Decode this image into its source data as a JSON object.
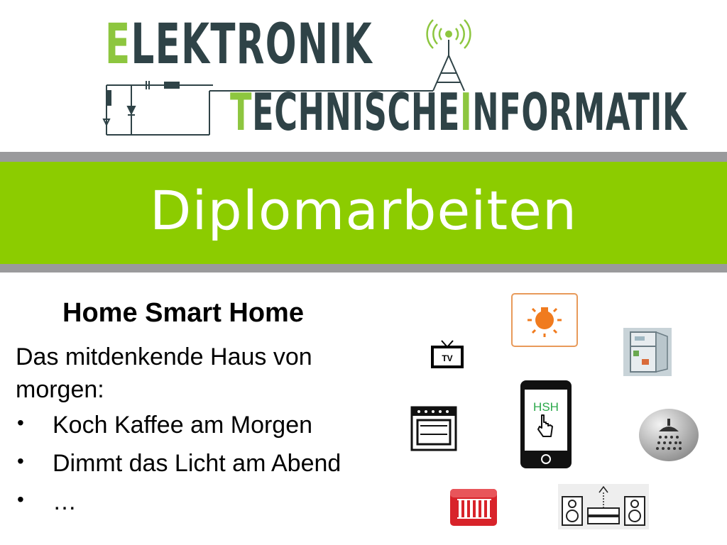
{
  "header": {
    "logo": {
      "word1_accent": "E",
      "word1_a": "LEK",
      "word1_b": "T",
      "word1_c": "RONIK",
      "word2_a": "T",
      "word2_b": "ECHNISCHE",
      "word2_c": "I",
      "word2_d": "NFORMATIK",
      "colors": {
        "dark": "#2f4347",
        "green": "#8dc63f"
      }
    },
    "banner_title": "Diplomarbeiten",
    "banner_color": "#8ccc00"
  },
  "content": {
    "subtitle": "Home Smart Home",
    "intro": "Das mitdenkende Haus von morgen:",
    "bullets": [
      {
        "marker": "•",
        "text": "Koch Kaffee am Morgen"
      },
      {
        "marker": "•",
        "text": "Dimmt das Licht am Abend"
      },
      {
        "marker": "•",
        "text": "…"
      }
    ]
  },
  "icons": {
    "tv_label": "TV",
    "phone_label": "HSH",
    "names": [
      "tv-icon",
      "light-bulb-icon",
      "fridge-icon",
      "stove-icon",
      "smartphone-icon",
      "shower-icon",
      "radiator-icon",
      "stereo-icon"
    ]
  }
}
